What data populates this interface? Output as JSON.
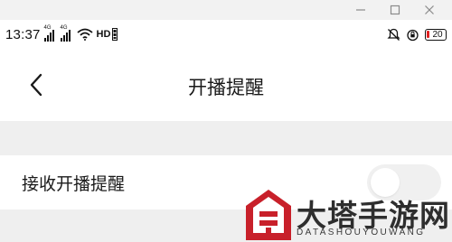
{
  "window_controls": [
    "minimize",
    "maximize",
    "close"
  ],
  "status_bar": {
    "time": "13:37",
    "signal_1_tag": "4G",
    "signal_2_tag": "4G",
    "hd_label": "HD",
    "battery_level": "20",
    "icons": [
      "signal-icon",
      "signal-icon",
      "wifi-icon",
      "hd-icon",
      "mute-icon",
      "alarm-icon",
      "battery-icon"
    ],
    "battery_color": "#e02020"
  },
  "header": {
    "back_icon": "chevron-left-icon",
    "title": "开播提醒"
  },
  "settings": {
    "row_label": "接收开播提醒",
    "toggle_on": false
  },
  "watermark": {
    "title": "大塔手游网",
    "subtitle": "DATASHOUYOUWANG",
    "color": "#c8202a"
  }
}
